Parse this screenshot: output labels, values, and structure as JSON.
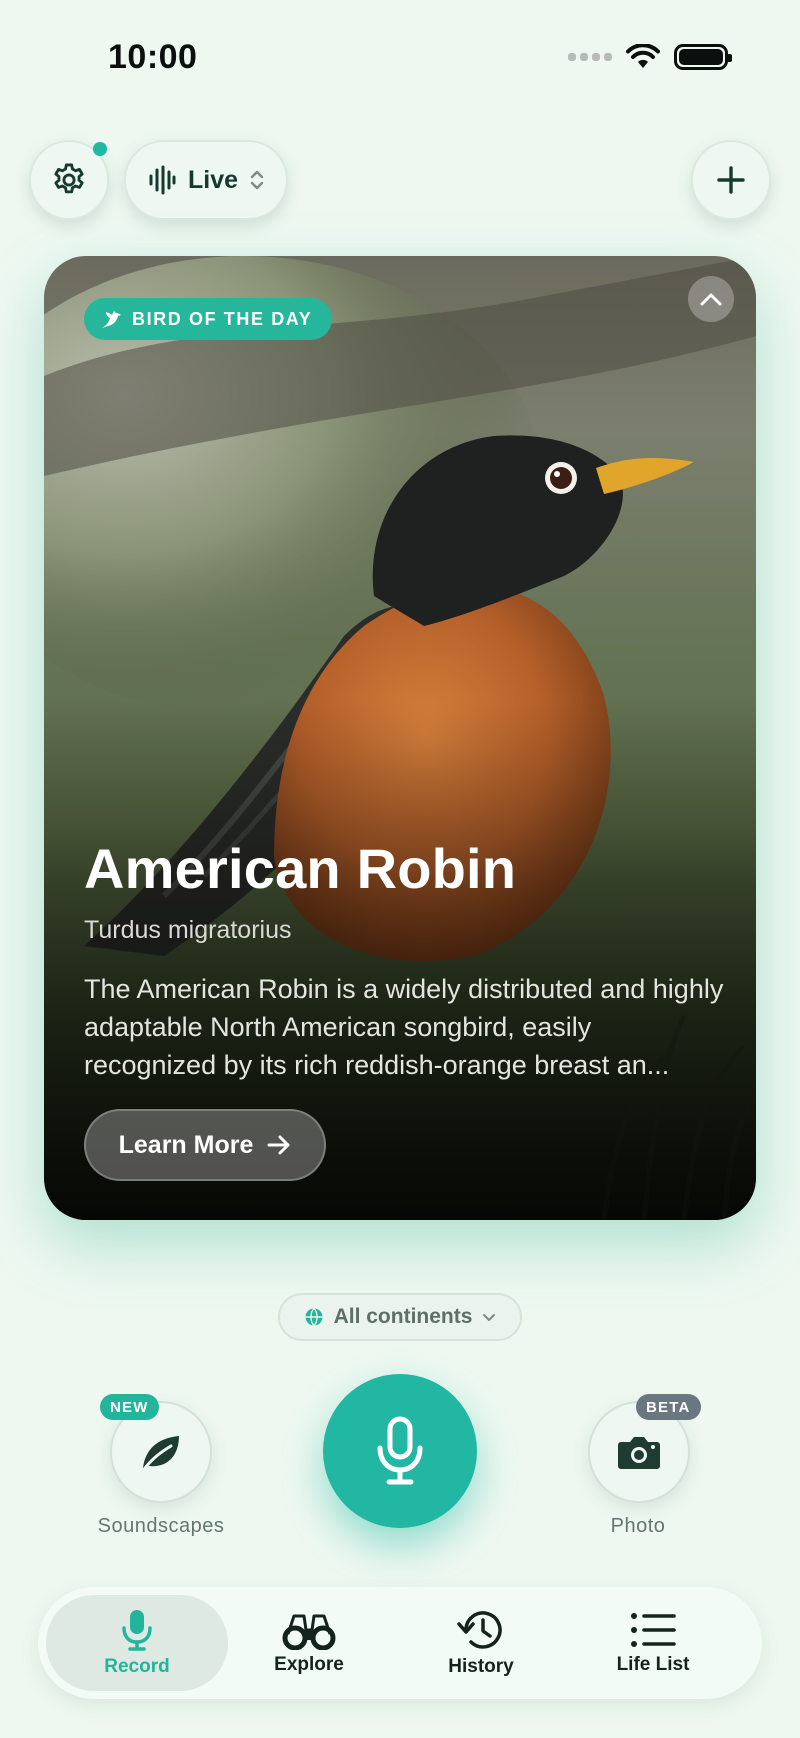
{
  "status_bar": {
    "time": "10:00"
  },
  "top_controls": {
    "mode_label": "Live"
  },
  "bird_of_day": {
    "badge": "BIRD OF THE DAY",
    "common_name": "American Robin",
    "scientific_name": "Turdus migratorius",
    "description": "The American Robin is a widely distributed and highly adaptable North American songbird, easily recognized by its rich reddish-orange breast an...",
    "learn_more": "Learn More"
  },
  "region_filter": {
    "selected": "All continents"
  },
  "actions": {
    "soundscapes": {
      "label": "Soundscapes",
      "tag": "NEW"
    },
    "photo": {
      "label": "Photo",
      "tag": "BETA"
    }
  },
  "bottom_nav": {
    "items": [
      {
        "label": "Record",
        "icon": "mic-icon",
        "active": true
      },
      {
        "label": "Explore",
        "icon": "binoculars-icon"
      },
      {
        "label": "History",
        "icon": "history-icon"
      },
      {
        "label": "Life List",
        "icon": "list-icon"
      }
    ]
  },
  "colors": {
    "accent": "#22b7a2",
    "background": "#eef8f1",
    "beta_tag": "#6a7780"
  }
}
